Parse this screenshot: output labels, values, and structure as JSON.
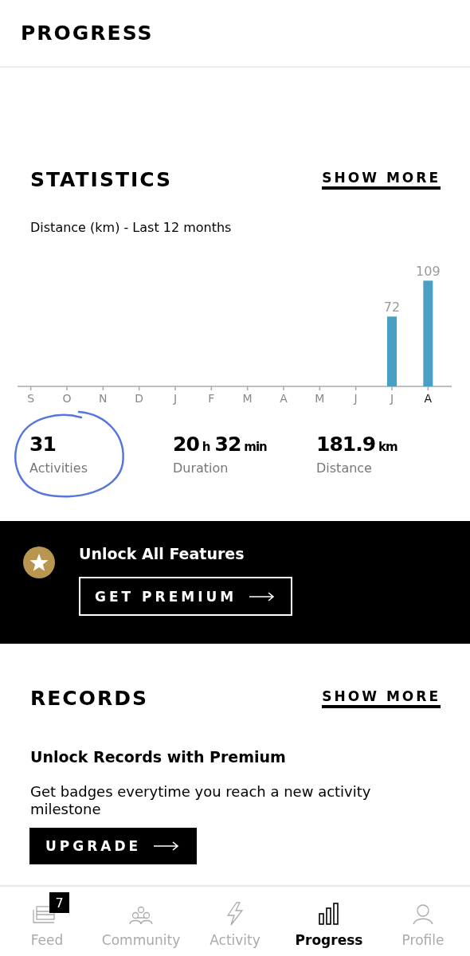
{
  "header": {
    "title": "PROGRESS"
  },
  "statistics": {
    "title": "STATISTICS",
    "show_more": "SHOW MORE",
    "subtitle": "Distance (km) - Last 12 months",
    "chart_data": {
      "type": "bar",
      "categories": [
        "S",
        "O",
        "N",
        "D",
        "J",
        "F",
        "M",
        "A",
        "M",
        "J",
        "J",
        "A"
      ],
      "series": [
        {
          "color": "#4a9fc4",
          "values": [
            null,
            null,
            null,
            null,
            null,
            null,
            null,
            null,
            null,
            null,
            72,
            109
          ]
        }
      ],
      "data_labels": true
    },
    "stats": [
      {
        "value": "31",
        "label": "Activities"
      },
      {
        "value": "20",
        "unit": "h",
        "value_2": "32",
        "unit_2": "min",
        "label": "Duration"
      },
      {
        "value": "181.9",
        "unit": "km",
        "label": "Distance"
      }
    ]
  },
  "premium": {
    "title": "Unlock All Features",
    "button": "GET PREMIUM"
  },
  "records": {
    "title": "RECORDS",
    "show_more": "SHOW MORE",
    "heading": "Unlock Records with Premium",
    "text": "Get badges everytime you reach a new activity milestone",
    "button": "UPGRADE"
  },
  "tabs": [
    {
      "label": "Feed",
      "badge": "7",
      "selected": false
    },
    {
      "label": "Community",
      "selected": false
    },
    {
      "label": "Activity",
      "selected": false
    },
    {
      "label": "Progress",
      "selected": true
    },
    {
      "label": "Profile",
      "selected": false
    }
  ]
}
